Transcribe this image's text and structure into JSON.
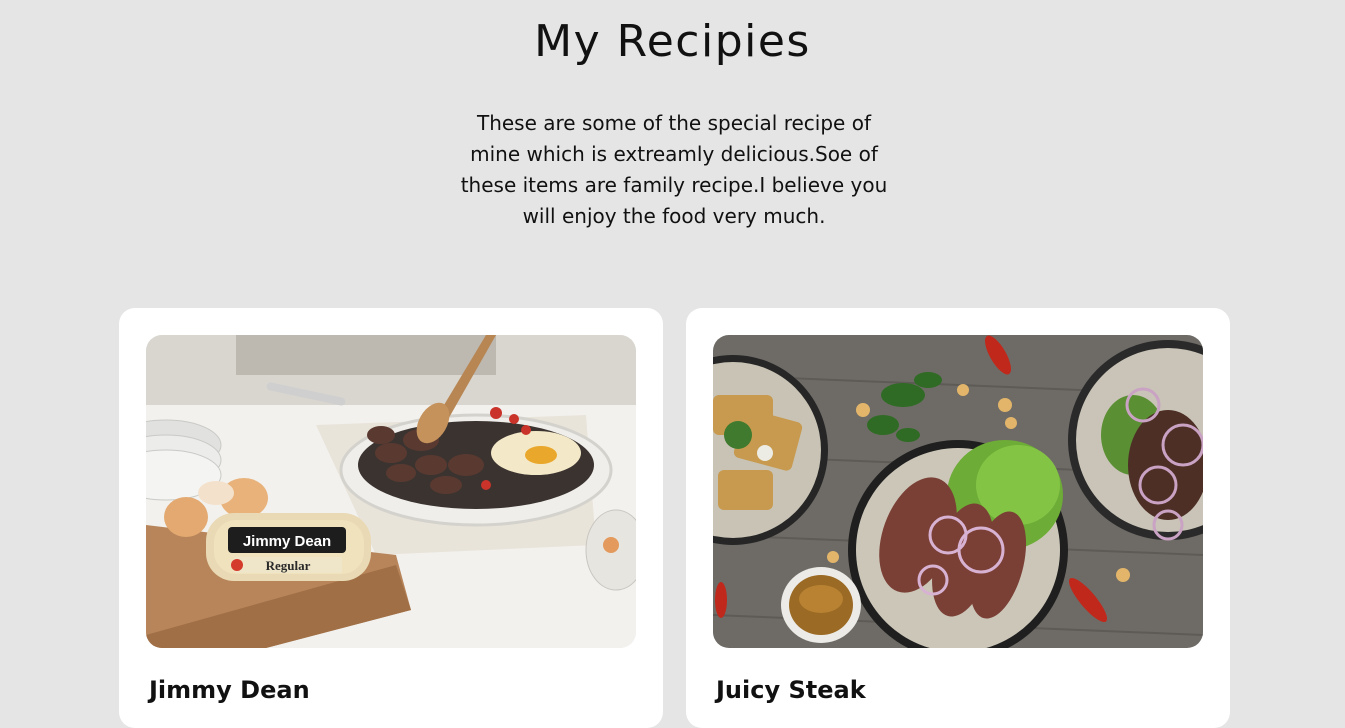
{
  "page": {
    "title": "My Recipies",
    "intro": "These are some of the special recipe of mine which is extreamly delicious.Soe of these items are family recipe.I believe you will enjoy the food very much."
  },
  "recipes": [
    {
      "name": "Jimmy Dean",
      "image_icon": "breakfast-skillet-photo",
      "package_brand": "Jimmy Dean",
      "package_variant": "Regular"
    },
    {
      "name": "Juicy Steak",
      "image_icon": "steak-salad-photo"
    }
  ],
  "colors": {
    "background": "#e5e5e5",
    "card": "#ffffff",
    "text": "#111111"
  }
}
